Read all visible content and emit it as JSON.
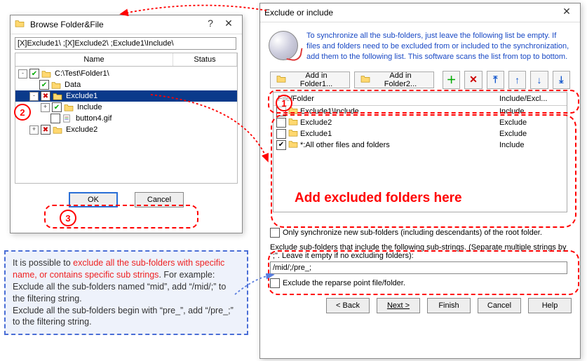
{
  "left": {
    "title": "Browse Folder&File",
    "path": "[X]Exclude1\\ ;[X]Exclude2\\ ;Exclude1\\Include\\",
    "col_name": "Name",
    "col_status": "Status",
    "nodes": [
      {
        "indent": 0,
        "exp": "-",
        "chk": "✔",
        "chkClass": "green",
        "label": "C:\\Test\\Folder1\\",
        "sel": false
      },
      {
        "indent": 1,
        "exp": "",
        "chk": "✔",
        "chkClass": "green",
        "label": "Data",
        "sel": false
      },
      {
        "indent": 1,
        "exp": "-",
        "chk": "✖",
        "chkClass": "red",
        "label": "Exclude1",
        "sel": true
      },
      {
        "indent": 2,
        "exp": "+",
        "chk": "✔",
        "chkClass": "green",
        "label": "Include",
        "sel": false
      },
      {
        "indent": 2,
        "exp": "",
        "chk": "",
        "chkClass": "",
        "label": "button4.gif",
        "sel": false,
        "isFile": true
      },
      {
        "indent": 1,
        "exp": "+",
        "chk": "✖",
        "chkClass": "red",
        "label": "Exclude2",
        "sel": false
      }
    ],
    "ok": "OK",
    "cancel": "Cancel"
  },
  "right": {
    "title": "Exclude or include",
    "info": "To synchronize all the sub-folders, just leave the following list be empty. If files and folders need to be excluded from or included to the synchronization, add them to the following list. This software scans the list from top to bottom.",
    "add1": "Add in Folder1...",
    "add2": "Add in Folder2...",
    "col_file": "File/Folder",
    "col_ie": "Include/Excl...",
    "rows": [
      {
        "chk": "",
        "label": "Exclude1\\Include",
        "ie": "Include"
      },
      {
        "chk": "",
        "label": "Exclude2",
        "ie": "Exclude"
      },
      {
        "chk": "",
        "label": "Exclude1",
        "ie": "Exclude"
      },
      {
        "chk": "✔",
        "label": "*:All other files and folders",
        "ie": "Include"
      }
    ],
    "only_sync": "Only synchronize new sub-folders (including descendants) of the root folder.",
    "excl_label": "Exclude sub-folders that include the following sub-strings. (Separate multiple strings by \";\". Leave it empty if no excluding folders):",
    "excl_value": "/mid/;/pre_;",
    "excl_reparse": "Exclude the reparse point file/folder.",
    "back": "< Back",
    "next": "Next >",
    "finish": "Finish",
    "cancel": "Cancel",
    "help": "Help"
  },
  "anno": {
    "big_red": "Add excluded folders here",
    "tip_p1": "It is possible to ",
    "tip_red": "exclude all the sub-folders with specific name, or contains specific sub strings",
    "tip_p2": ". For example:\nExclude all the sub-folders named “mid”, add “/mid/;” to the filtering string.\nExclude all the sub-folders begin with “pre_”, add “/pre_;” to the filtering string."
  }
}
